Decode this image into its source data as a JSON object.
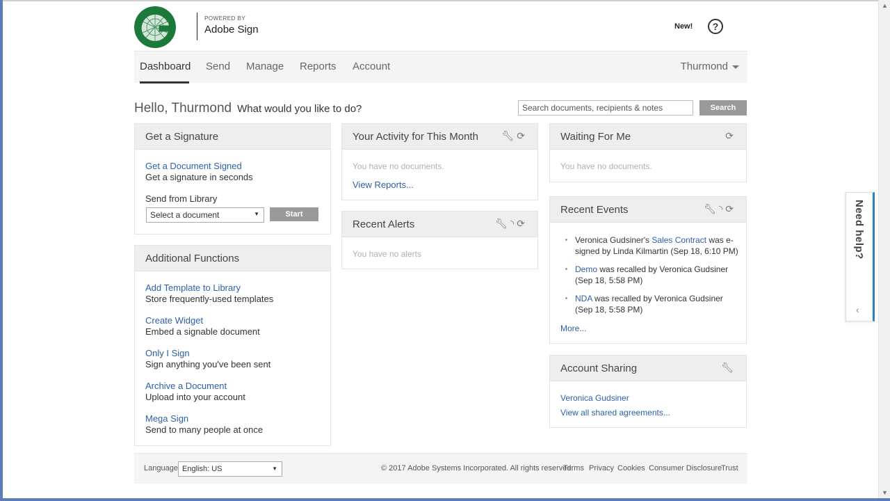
{
  "header": {
    "powered_by": "POWERED BY",
    "brand": "Adobe Sign",
    "new_label": "New!",
    "help_symbol": "?"
  },
  "nav": {
    "items": [
      {
        "label": "Dashboard",
        "active": true
      },
      {
        "label": "Send"
      },
      {
        "label": "Manage"
      },
      {
        "label": "Reports"
      },
      {
        "label": "Account"
      }
    ],
    "user": "Thurmond"
  },
  "greeting": {
    "hello": "Hello, Thurmond",
    "prompt": "What would you like to do?"
  },
  "search": {
    "placeholder": "Search documents, recipients & notes",
    "button": "Search"
  },
  "get_signature": {
    "title": "Get a Signature",
    "link": "Get a Document Signed",
    "desc": "Get a signature in seconds",
    "library_label": "Send from Library",
    "select_value": "Select a document",
    "start_button": "Start"
  },
  "additional": {
    "title": "Additional Functions",
    "items": [
      {
        "link": "Add Template to Library",
        "desc": "Store frequently-used templates"
      },
      {
        "link": "Create Widget",
        "desc": "Embed a signable document"
      },
      {
        "link": "Only I Sign",
        "desc": "Sign anything you've been sent"
      },
      {
        "link": "Archive a Document",
        "desc": "Upload into your account"
      },
      {
        "link": "Mega Sign",
        "desc": "Send to many people at once"
      }
    ]
  },
  "activity": {
    "title": "Your Activity for This Month",
    "empty": "You have no documents.",
    "link": "View Reports..."
  },
  "alerts": {
    "title": "Recent Alerts",
    "empty": "You have no alerts"
  },
  "waiting": {
    "title": "Waiting For Me",
    "empty": "You have no documents."
  },
  "events": {
    "title": "Recent Events",
    "items": [
      {
        "pre": "Veronica Gudsiner's ",
        "link": "Sales Contract",
        "post": " was e-signed by Linda Kilmartin (Sep 18, 6:10 PM)"
      },
      {
        "pre": "",
        "link": "Demo",
        "post": " was recalled by Veronica Gudsiner (Sep 18, 5:58 PM)"
      },
      {
        "pre": "",
        "link": "NDA",
        "post": " was recalled by Veronica Gudsiner (Sep 18, 5:58 PM)"
      }
    ],
    "more": "More..."
  },
  "sharing": {
    "title": "Account Sharing",
    "user_link": "Veronica Gudsiner",
    "all_link": "View all shared agreements..."
  },
  "footer": {
    "language_label": "Language",
    "language_value": "English: US",
    "copyright": "© 2017 Adobe Systems Incorporated. All rights reserved.",
    "links": [
      "Terms",
      "Privacy",
      "Cookies",
      "Consumer Disclosure",
      "Trust"
    ]
  },
  "help_tab": {
    "label": "Need help?"
  },
  "colors": {
    "link": "#2c5fa8",
    "brand_green": "#1b7a3a",
    "help_accent": "#2c7fc1"
  }
}
